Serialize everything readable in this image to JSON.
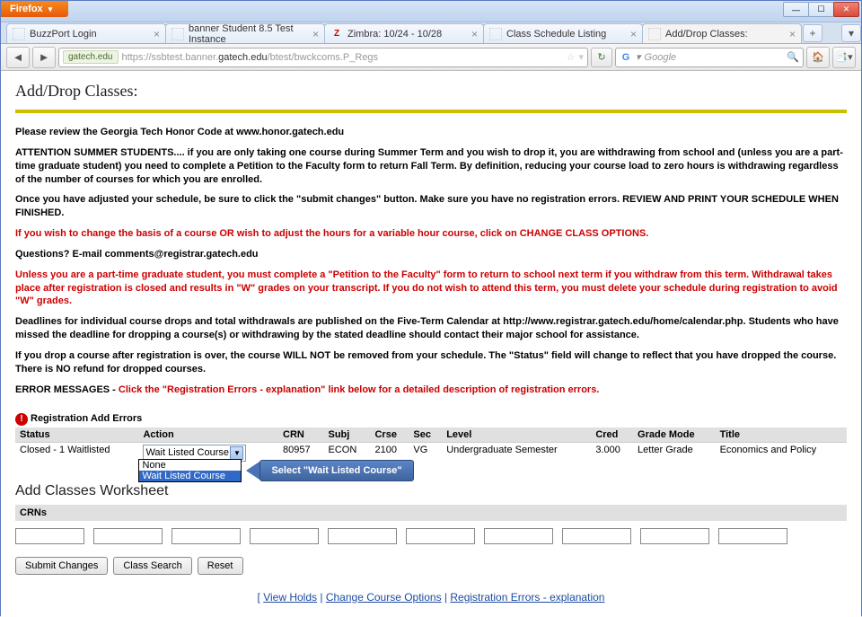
{
  "titlebar": {
    "firefox_label": "Firefox",
    "minimize": "—",
    "maximize": "☐",
    "close": "✕"
  },
  "tabs": [
    {
      "label": "BuzzPort Login",
      "favicon": ""
    },
    {
      "label": "banner Student 8.5 Test Instance",
      "favicon": ""
    },
    {
      "label": "Zimbra: 10/24 - 10/28",
      "favicon": "Z"
    },
    {
      "label": "Class Schedule Listing",
      "favicon": ""
    },
    {
      "label": "Add/Drop Classes:",
      "favicon": ""
    }
  ],
  "navbar": {
    "url_prefix": "gatech.edu",
    "url_gray_before": "https://ssbtest.banner.",
    "url_domain": "gatech.edu",
    "url_gray_after": "/btest/bwckcoms.P_Regs",
    "search_placeholder": "Google"
  },
  "content": {
    "page_title": "Add/Drop Classes:",
    "p_honor": "Please review the Georgia Tech Honor Code at www.honor.gatech.edu",
    "p_summer": "ATTENTION SUMMER STUDENTS.... if you are only taking one course during Summer Term and you wish to drop it, you are withdrawing from school and (unless you are a part-time graduate student) you need to complete a Petition to the Faculty form to return Fall Term. By definition, reducing your course load to zero hours is withdrawing regardless of the number of courses for which you are enrolled.",
    "p_submit": "Once you have adjusted your schedule, be sure to click the \"submit changes\" button. Make sure you have no registration errors. REVIEW AND PRINT YOUR SCHEDULE WHEN FINISHED.",
    "p_change_basis": "If you wish to change the basis of a course OR wish to adjust the hours for a variable hour course, click on CHANGE CLASS OPTIONS.",
    "p_questions": "Questions? E-mail comments@registrar.gatech.edu",
    "p_petition": "Unless you are a part-time graduate student, you must complete a \"Petition to the Faculty\" form to return to school next term if you withdraw from this term. Withdrawal takes place after registration is closed and results in \"W\" grades on your transcript. If you do not wish to attend this term, you must delete your schedule during registration to avoid \"W\" grades.",
    "p_deadlines": "Deadlines for individual course drops and total withdrawals are published on the Five-Term Calendar at http://www.registrar.gatech.edu/home/calendar.php. Students who have missed the deadline for dropping a course(s) or withdrawing by the stated deadline should contact their major school for assistance.",
    "p_dropnote": "If you drop a course after registration is over, the course WILL NOT be removed from your schedule. The \"Status\" field will change to reflect that you have dropped the course. There is NO refund for dropped courses.",
    "p_errmsg_lead": "ERROR MESSAGES - ",
    "p_errmsg_red": "Click the \"Registration Errors - explanation\" link below for a detailed description of registration errors.",
    "err_heading": "Registration Add Errors",
    "table": {
      "headers": [
        "Status",
        "Action",
        "CRN",
        "Subj",
        "Crse",
        "Sec",
        "Level",
        "Cred",
        "Grade Mode",
        "Title"
      ],
      "row": {
        "status": "Closed - 1 Waitlisted",
        "crn": "80957",
        "subj": "ECON",
        "crse": "2100",
        "sec": "VG",
        "level": "Undergraduate Semester",
        "cred": "3.000",
        "grade_mode": "Letter Grade",
        "title": "Economics and Policy",
        "selected_action": "Wait Listed Course",
        "options": [
          "None",
          "Wait Listed Course"
        ]
      }
    },
    "callout": "Select \"Wait Listed Course\"",
    "worksheet_heading": "Add Classes Worksheet",
    "crns_label": "CRNs",
    "buttons": {
      "submit": "Submit Changes",
      "class_search": "Class Search",
      "reset": "Reset"
    },
    "bottom_links": {
      "left_bracket": "[ ",
      "view_holds": "View Holds",
      "sep": " | ",
      "change_opts": "Change Course Options",
      "reg_errors": "Registration Errors - explanation"
    }
  }
}
